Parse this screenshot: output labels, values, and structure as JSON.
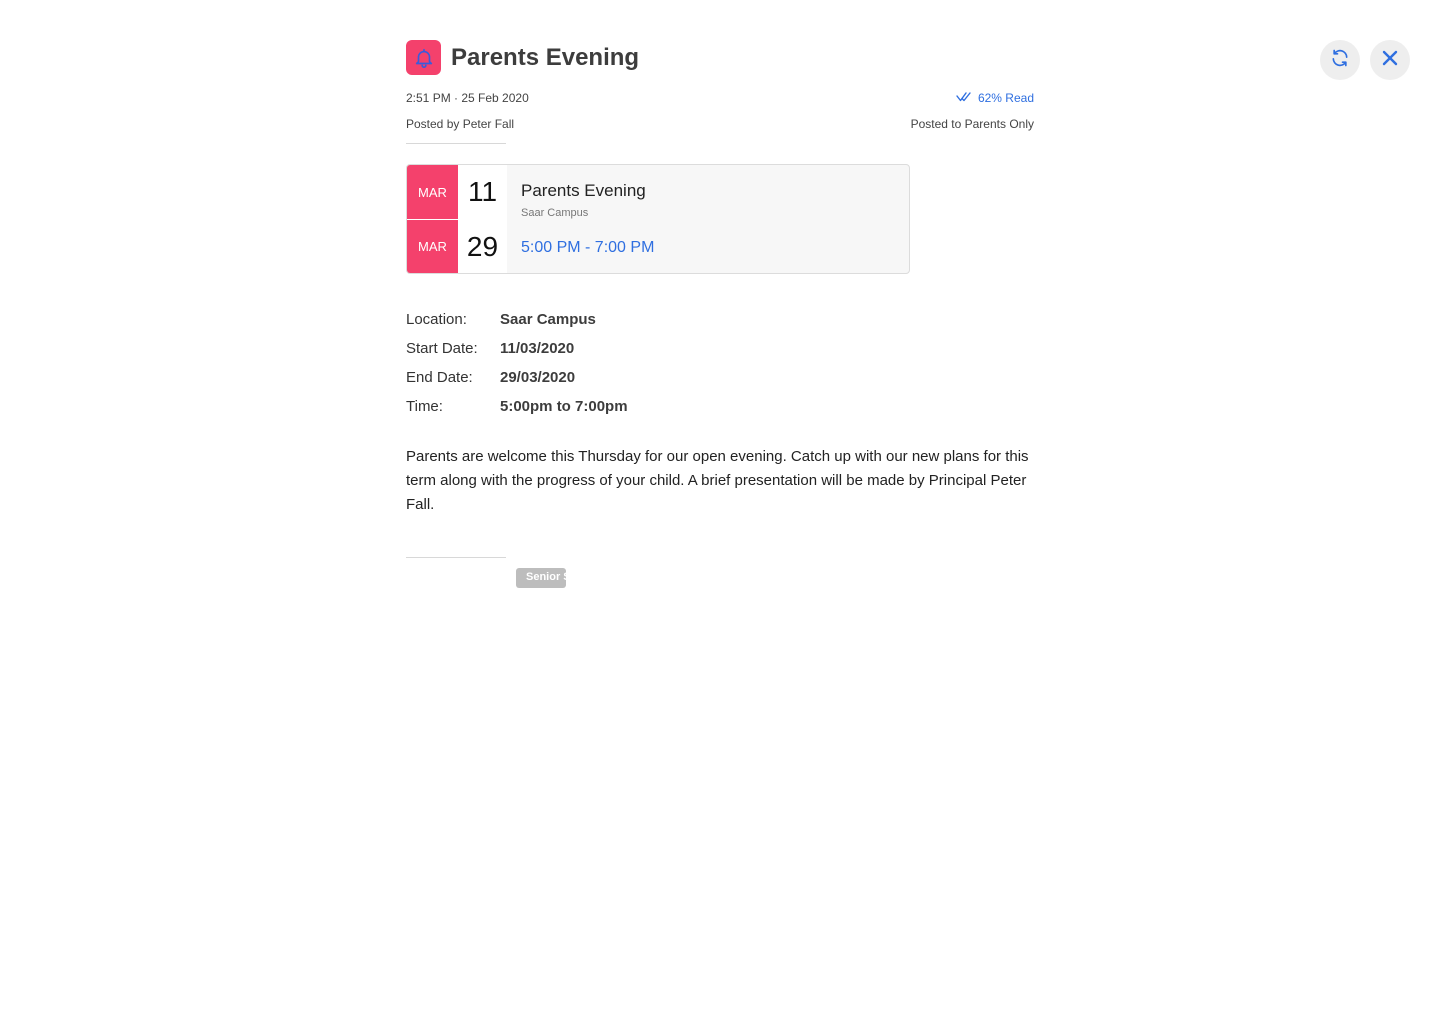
{
  "header": {
    "title": "Parents Evening",
    "timestamp": "2:51 PM · 25 Feb 2020",
    "posted_by": "Posted by Peter Fall",
    "read_status": "62% Read",
    "audience": "Posted to Parents Only"
  },
  "event_card": {
    "start_month": "MAR",
    "start_day": "11",
    "end_month": "MAR",
    "end_day": "29",
    "title": "Parents Evening",
    "subtitle": "Saar Campus",
    "time_range": "5:00 PM - 7:00 PM"
  },
  "details": {
    "location_label": "Location:",
    "location_value": "Saar Campus",
    "start_label": "Start Date:",
    "start_value": "11/03/2020",
    "end_label": "End Date:",
    "end_value": "29/03/2020",
    "time_label": "Time:",
    "time_value": "5:00pm to 7:00pm"
  },
  "description": "Parents are welcome this Thursday for our open evening. Catch up with our new plans for this term along with the progress of your child. A brief presentation will be made by Principal Peter Fall.",
  "tags": [
    "Senior School"
  ],
  "icons": {
    "bell": "bell-icon",
    "refresh": "refresh-icon",
    "close": "close-icon",
    "read": "double-check-icon"
  },
  "colors": {
    "accent": "#f4416c",
    "link": "#2f6fe0"
  }
}
